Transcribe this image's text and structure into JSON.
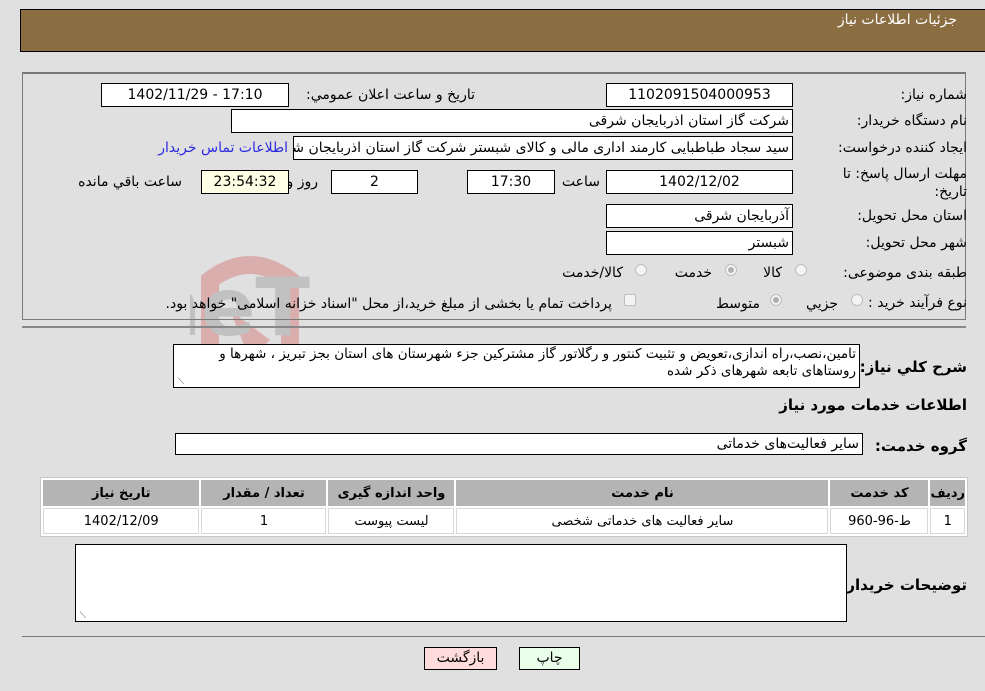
{
  "header": {
    "title": "جزئیات اطلاعات نیاز"
  },
  "form": {
    "need_number": {
      "label": "شماره نیاز:",
      "value": "1102091504000953"
    },
    "announce_datetime": {
      "label": "تاریخ و ساعت اعلان عمومي:",
      "value": "1402/11/29 - 17:10"
    },
    "buyer_org": {
      "label": "نام دستگاه خريدار:",
      "value": "شرکت گاز استان اذربایجان شرقی"
    },
    "requester": {
      "label": "ایجاد کننده درخواست:",
      "value": "سید سجاد  طباطبایی کارمند اداری مالی و کالای شبستر  شرکت گاز استان اذربایجان شرقی"
    },
    "contact_link": "اطلاعات تماس خریدار",
    "deadline": {
      "label": "مهلت ارسال پاسخ: تا تاریخ:",
      "date": "1402/12/02",
      "time_label": "ساعت",
      "time": "17:30",
      "days": "2",
      "days_label": "روز و",
      "remaining": "23:54:32",
      "remaining_label": "ساعت باقي مانده"
    },
    "delivery_province": {
      "label": "استان محل تحویل:",
      "value": "آذربایجان شرقی"
    },
    "delivery_city": {
      "label": "شهر محل تحویل:",
      "value": "شبستر"
    },
    "category": {
      "label": "طبقه بندی موضوعی:",
      "options": [
        "کالا",
        "خدمت",
        "کالا/خدمت"
      ],
      "selected": "خدمت"
    },
    "purchase_type": {
      "label": "نوع فرآیند خرید :",
      "options": [
        "جزيي",
        "متوسط"
      ],
      "selected": "متوسط",
      "treasury_note": "پرداخت تمام یا بخشی از مبلغ خرید،از محل \"اسناد خزانه اسلامی\" خواهد بود.",
      "treasury_checked": false
    }
  },
  "description": {
    "label": "شرح کلي نياز:",
    "value": "تامین،نصب،راه اندازی،تعویض و تثبیت کنتور  و رگلاتور گاز مشترکین جزء شهرستان های استان بجز تبریز ، شهرها و روستاهای تابعه شهرهای ذکر شده"
  },
  "services_section": {
    "title": "اطلاعات خدمات مورد نياز",
    "group_label": "گروه خدمت:",
    "group_value": "سایر فعالیت‌های خدماتی"
  },
  "table": {
    "headers": [
      "رديف",
      "کد خدمت",
      "نام خدمت",
      "واحد اندازه گيری",
      "تعداد / مقدار",
      "تاريخ نياز"
    ],
    "rows": [
      [
        "1",
        "ط-96-960",
        "سایر فعالیت های خدماتی شخصی",
        "لیست پیوست",
        "1",
        "1402/12/09"
      ]
    ]
  },
  "buyer_notes": {
    "label": "توضيحات خريدار:",
    "value": ""
  },
  "buttons": {
    "print": "چاپ",
    "back": "بازگشت"
  },
  "colors": {
    "header_bg": "#8b6d42",
    "print_bg": "#eaffea",
    "back_bg": "#ffdcdc",
    "link": "#2a2ae0"
  }
}
